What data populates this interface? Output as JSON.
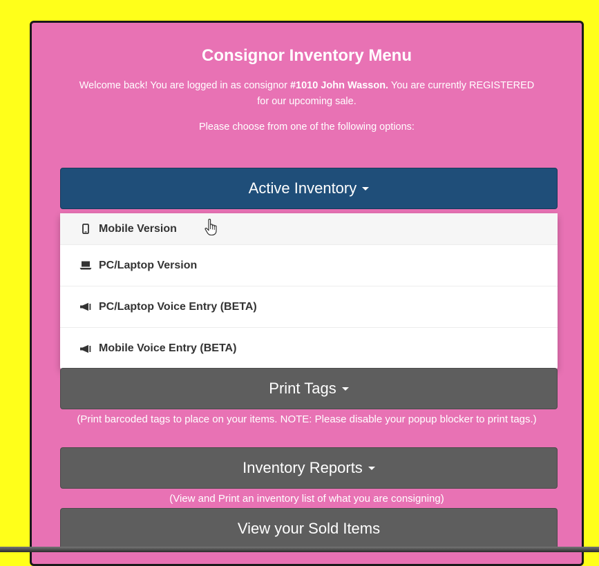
{
  "menu": {
    "title": "Consignor Inventory Menu",
    "welcome": {
      "prefix": "Welcome back! You are logged in as consignor ",
      "consignor": "#1010 John Wasson.",
      "suffix": " You are currently REGISTERED for our upcoming sale."
    },
    "prompt": "Please choose from one of the following options:"
  },
  "buttons": {
    "active_inventory": "Active Inventory",
    "print_tags": "Print Tags",
    "inventory_reports": "Inventory Reports",
    "view_sold": "View your Sold Items"
  },
  "dropdown": {
    "items": [
      {
        "label": "Mobile Version",
        "icon": "mobile-phone-icon"
      },
      {
        "label": "PC/Laptop Version",
        "icon": "laptop-icon"
      },
      {
        "label": "PC/Laptop Voice Entry (BETA)",
        "icon": "megaphone-icon"
      },
      {
        "label": "Mobile Voice Entry (BETA)",
        "icon": "megaphone-icon"
      }
    ]
  },
  "hints": {
    "print_tags": "(Print barcoded tags to place on your items. NOTE: Please disable your popup blocker to print tags.)",
    "inventory_reports": "(View and Print an inventory list of what you are consigning)"
  },
  "colors": {
    "page_background": "#ffff1a",
    "panel": "#e872b4",
    "primary_button": "#1f4e79",
    "dark_button": "#5e5e5e"
  }
}
